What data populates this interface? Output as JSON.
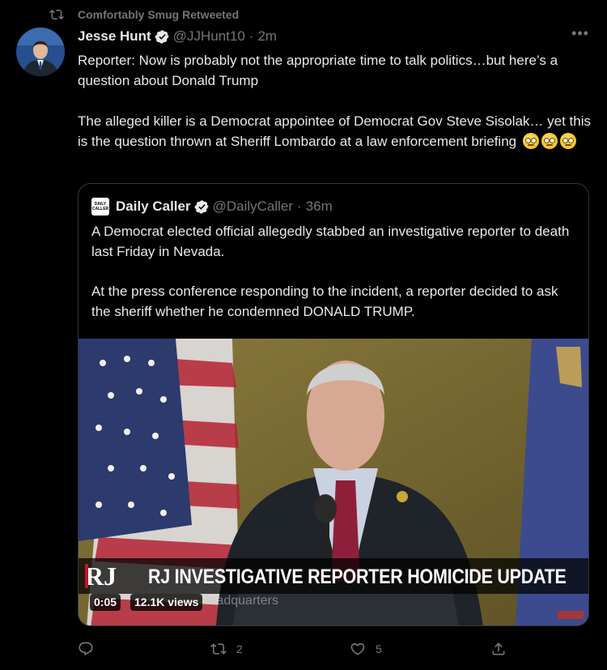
{
  "retweet": {
    "icon": "retweet-icon",
    "label": "Comfortably Smug Retweeted"
  },
  "tweet": {
    "avatar": "avatar",
    "name": "Jesse Hunt",
    "verified_icon": "verified-badge-icon",
    "handle": "@JJHunt10",
    "dot": "·",
    "time": "2m",
    "more_icon": "more-options-icon",
    "text_line1": "Reporter: Now is probably not the appropriate time to talk politics…but here’s a question about Donald Trump",
    "text_line2": "The alleged killer is a Democrat appointee of Democrat Gov Steve Sisolak… yet this is the question thrown at Sheriff Lombardo at a law enforcement briefing",
    "emoji": [
      "rolling-eyes-emoji",
      "rolling-eyes-emoji",
      "rolling-eyes-emoji"
    ]
  },
  "quote": {
    "logo_text": "DAILY CALLER",
    "name": "Daily Caller",
    "verified_icon": "verified-badge-icon",
    "handle": "@DailyCaller",
    "dot": "·",
    "time": "36m",
    "text_line1": "A Democrat elected official allegedly stabbed an investigative reporter to death last Friday in Nevada.",
    "text_line2": "At the press conference responding to the incident, a reporter decided to ask the sheriff whether he condemned DONALD TRUMP."
  },
  "video": {
    "logo": "RJ",
    "headline": "RJ INVESTIGATIVE REPORTER HOMICIDE UPDATE",
    "subline": "Headquarters",
    "timestamp": "0:05",
    "views": "12.1K views"
  },
  "actions": {
    "reply_icon": "reply-icon",
    "retweet_icon": "retweet-icon",
    "retweet_count": "2",
    "like_icon": "like-heart-icon",
    "like_count": "5",
    "share_icon": "share-icon"
  },
  "colors": {
    "background": "#000000",
    "text": "#e7e9ea",
    "muted": "#71767b",
    "verified": "#1d9bf0",
    "border": "#333639"
  }
}
